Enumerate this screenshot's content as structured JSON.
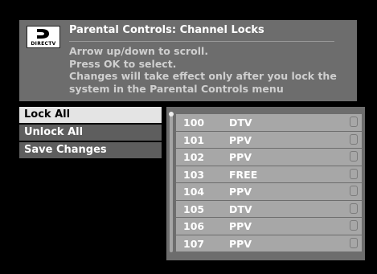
{
  "header": {
    "logo_text": "DIRECTV",
    "title": "Parental Controls: Channel Locks",
    "instructions": [
      "Arrow up/down to scroll.",
      "Press OK to select.",
      "Changes will take effect only after you lock the",
      "system in the Parental Controls menu"
    ]
  },
  "menu": {
    "items": [
      {
        "label": "Lock All",
        "selected": true
      },
      {
        "label": "Unlock All",
        "selected": false
      },
      {
        "label": "Save Changes",
        "selected": false
      }
    ]
  },
  "channels": [
    {
      "number": "100",
      "type": "DTV",
      "locked": false
    },
    {
      "number": "101",
      "type": "PPV",
      "locked": false
    },
    {
      "number": "102",
      "type": "PPV",
      "locked": false
    },
    {
      "number": "103",
      "type": "FREE",
      "locked": false
    },
    {
      "number": "104",
      "type": "PPV",
      "locked": false
    },
    {
      "number": "105",
      "type": "DTV",
      "locked": false
    },
    {
      "number": "106",
      "type": "PPV",
      "locked": false
    },
    {
      "number": "107",
      "type": "PPV",
      "locked": false
    }
  ],
  "colors": {
    "panel": "#6d6d6d",
    "row": "#a7a7a7",
    "selected": "#e4e4e4",
    "background": "#000000"
  }
}
